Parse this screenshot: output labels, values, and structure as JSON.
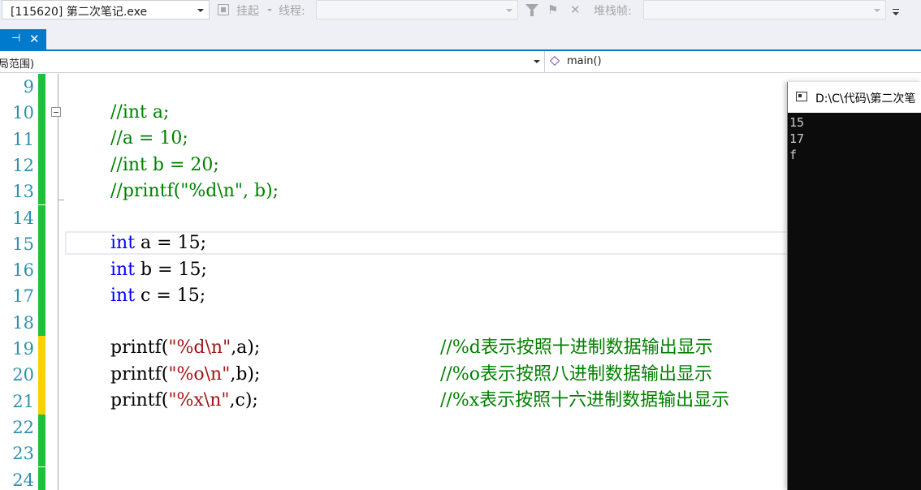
{
  "toolbar": {
    "process": "[115620] 第二次笔记.exe",
    "suspend_label": "挂起",
    "thread_label": "线程:",
    "stack_frame_label": "堆栈帧:"
  },
  "tab": {
    "pin_glyph": "⊣",
    "close_glyph": "✕"
  },
  "navbar": {
    "scope": "局范围)",
    "member": "main()"
  },
  "editor": {
    "line_numbers": [
      "9",
      "10",
      "11",
      "12",
      "13",
      "14",
      "15",
      "16",
      "17",
      "18",
      "19",
      "20",
      "21",
      "22",
      "23",
      "24"
    ],
    "change_markers": [
      "green",
      "green",
      "green",
      "green",
      "green",
      "green",
      "green",
      "green",
      "green",
      "green",
      "yellow",
      "yellow",
      "yellow",
      "green",
      "green",
      "green"
    ],
    "lines": {
      "l10": "//int a;",
      "l11": "//a = 10;",
      "l12": "//int b = 20;",
      "l13": "//printf(\"%d\\n\", b);",
      "l15_kw": "int",
      "l15_rest": " a = 15;",
      "l16_kw": "int",
      "l16_rest": " b = 15;",
      "l17_kw": "int",
      "l17_rest": " c = 15;",
      "l19_code_a": "printf(",
      "l19_str": "\"%d\\n\"",
      "l19_code_b": ",a);",
      "l19_comment": "//%d表示按照十进制数据输出显示",
      "l20_code_a": "printf(",
      "l20_str": "\"%o\\n\"",
      "l20_code_b": ",b);",
      "l20_comment": "//%o表示按照八进制数据输出显示",
      "l21_code_a": "printf(",
      "l21_str": "\"%x\\n\"",
      "l21_code_b": ",c);",
      "l21_comment": "//%x表示按照十六进制数据输出显示"
    }
  },
  "console": {
    "title": "D:\\C\\代码\\第二次笔",
    "output": [
      "15",
      "17",
      "f"
    ]
  },
  "colors": {
    "accent": "#007acc",
    "line_number": "#2b91af",
    "comment": "#008000",
    "keyword": "#0000ff",
    "string": "#a31515",
    "saved_change": "#1ec13b",
    "unsaved_change": "#f7d100"
  }
}
